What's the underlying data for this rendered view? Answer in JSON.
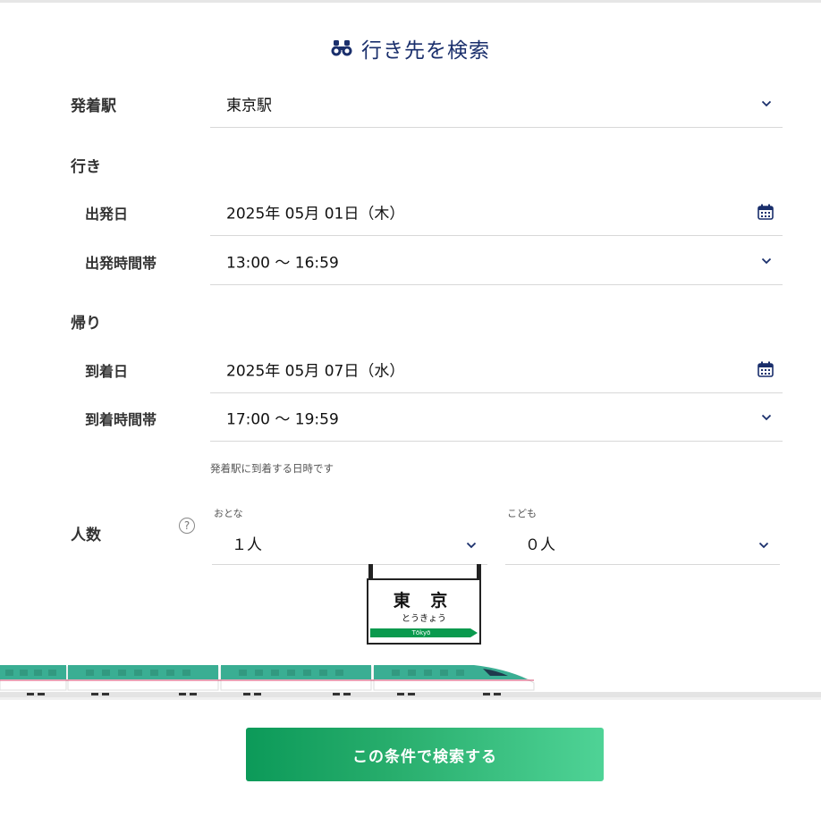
{
  "title": "行き先を検索",
  "departure_station": {
    "label": "発着駅",
    "value": "東京駅"
  },
  "outbound": {
    "section_label": "行き",
    "date_label": "出発日",
    "date_value": "2025年 05月 01日（木）",
    "time_label": "出発時間帯",
    "time_value": "13:00 〜 16:59"
  },
  "return": {
    "section_label": "帰り",
    "date_label": "到着日",
    "date_value": "2025年 05月 07日（水）",
    "time_label": "到着時間帯",
    "time_value": "17:00 〜 19:59",
    "note": "発着駅に到着する日時です"
  },
  "passengers": {
    "label": "人数",
    "help": "?",
    "adult_caption": "おとな",
    "adult_value": "１人",
    "child_caption": "こども",
    "child_value": "０人"
  },
  "station_sign": {
    "kanji": "東 京",
    "kana": "とうきょう",
    "romaji": "Tōkyō"
  },
  "search_button": "この条件で検索する",
  "colors": {
    "accent_navy": "#1a2f6c",
    "button_green": "#0c9a59",
    "train_teal": "#3aae93"
  }
}
